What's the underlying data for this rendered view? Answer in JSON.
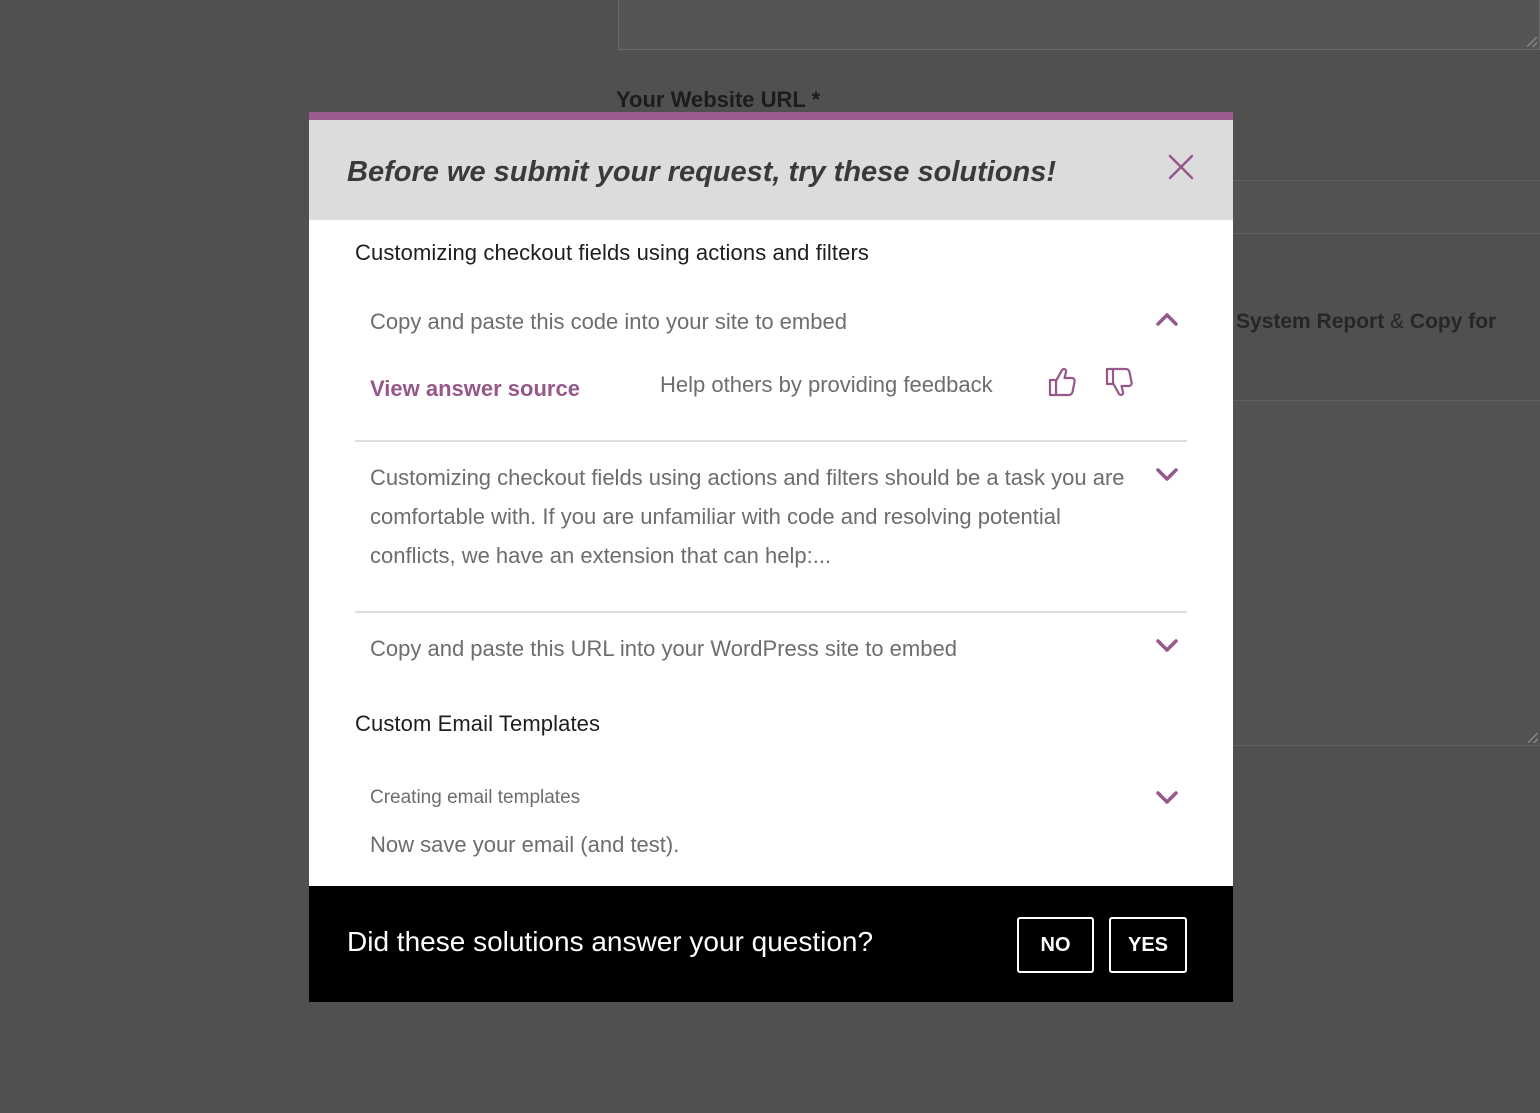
{
  "background": {
    "field_label": "Your Website URL *",
    "system_report": {
      "part1": "System Report",
      "sep": " & ",
      "part2": "Copy for"
    }
  },
  "modal": {
    "title": "Before we submit your request, try these solutions!",
    "accent_color": "#96588a",
    "sections": [
      {
        "title": "Customizing checkout fields using actions and filters",
        "items": [
          {
            "text": "Copy and paste this code into your site to embed",
            "expanded": true,
            "view_source_label": "View answer source",
            "feedback_label": "Help others by providing feedback"
          },
          {
            "text": "Customizing checkout fields using actions and filters should be a task you are comfortable with. If you are unfamiliar with code and resolving potential conflicts, we have an extension that can help:...",
            "expanded": false
          },
          {
            "text": "Copy and paste this URL into your WordPress site to embed",
            "expanded": false
          }
        ]
      },
      {
        "title": "Custom Email Templates",
        "items": [
          {
            "subtitle": "Creating email templates",
            "text": "Now save your email (and test).",
            "expanded": false
          }
        ]
      }
    ],
    "footer": {
      "question": "Did these solutions answer your question?",
      "no_label": "NO",
      "yes_label": "YES"
    }
  }
}
